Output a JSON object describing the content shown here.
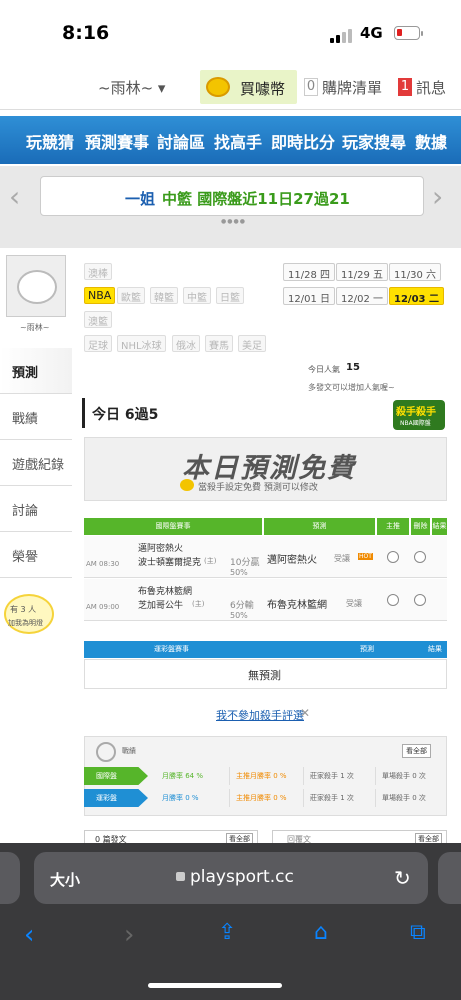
{
  "status": {
    "time": "8:16",
    "network": "4G"
  },
  "header": {
    "username": "~雨林~ ▾",
    "coins": "買噱幣",
    "cart_count": "0",
    "cart": "購牌清單",
    "msg_count": "1",
    "msg": "訊息"
  },
  "nav": [
    "玩競猜",
    "預測賽事",
    "討論區",
    "找高手",
    "即時比分",
    "玩家搜尋",
    "數據"
  ],
  "banner": {
    "part1": "一姐",
    "part2": "中籃 國際盤近11日27過21"
  },
  "profile": {
    "name": "~雨林~"
  },
  "left_tabs": [
    "預測",
    "戰績",
    "遊戲紀錄",
    "討論",
    "榮譽"
  ],
  "fans": {
    "line1": "有 3 人",
    "line2": "加我為明燈"
  },
  "sports": {
    "row1": [
      "澳棒"
    ],
    "row2": [
      "NBA",
      "歐籃",
      "韓籃",
      "中籃",
      "日籃"
    ],
    "row3": [
      "澳籃"
    ],
    "row4": [
      "足球",
      "NHL冰球",
      "俄冰",
      "賽馬",
      "美足"
    ],
    "active": "NBA"
  },
  "dates": [
    "11/28 四",
    "11/29 五",
    "11/30 六",
    "12/01 日",
    "12/02 一",
    "12/03 二"
  ],
  "active_date": "12/03 二",
  "popularity": {
    "label": "今日人氣",
    "value": "15",
    "tip": "多發文可以增加人氣喔~"
  },
  "badge": {
    "title": "殺手殺手",
    "sub": "NBA國際盤"
  },
  "today": "今日 6過5",
  "free": {
    "title": "本日預測免費",
    "sub": "當殺手設定免費 預測可以修改"
  },
  "table1": {
    "headers": [
      "國際盤賽事",
      "預測",
      "主推",
      "刪除",
      "結果"
    ],
    "rows": [
      {
        "time": "AM 08:30",
        "home": "邁阿密熱火",
        "away": "波士頓塞爾提克",
        "mark": "(主)",
        "line": "10分贏",
        "pct": "50%",
        "pick": "邁阿密熱火",
        "pick_tag": "受讓",
        "hot": "HOT"
      },
      {
        "time": "AM 09:00",
        "home": "布魯克林籃網",
        "away": "芝加哥公牛",
        "mark": "(主)",
        "line": "6分輸",
        "pct": "50%",
        "pick": "布魯克林籃網",
        "pick_tag": "受讓"
      }
    ]
  },
  "table2": {
    "headers": [
      "運彩盤賽事",
      "預測",
      "結果"
    ],
    "empty": "無預測"
  },
  "optout": "我不參加殺手評選",
  "record": {
    "title": "戰績",
    "all": "看全部",
    "rows": [
      {
        "tag": "國際盤",
        "win": "月勝率 64 %",
        "main": "主推月勝率 0 %",
        "zh": "莊家殺手 1 次",
        "single": "單場殺手 0 次"
      },
      {
        "tag": "運彩盤",
        "win": "月勝率 0 %",
        "main": "主推月勝率 0 %",
        "zh": "莊家殺手 1 次",
        "single": "單場殺手 0 次"
      }
    ]
  },
  "bottom": {
    "left": "0 篇發文",
    "left_btn": "看全部",
    "right": "回覆文",
    "right_btn": "看全部"
  },
  "safari": {
    "aa": "大小",
    "url": "playsport.cc"
  }
}
